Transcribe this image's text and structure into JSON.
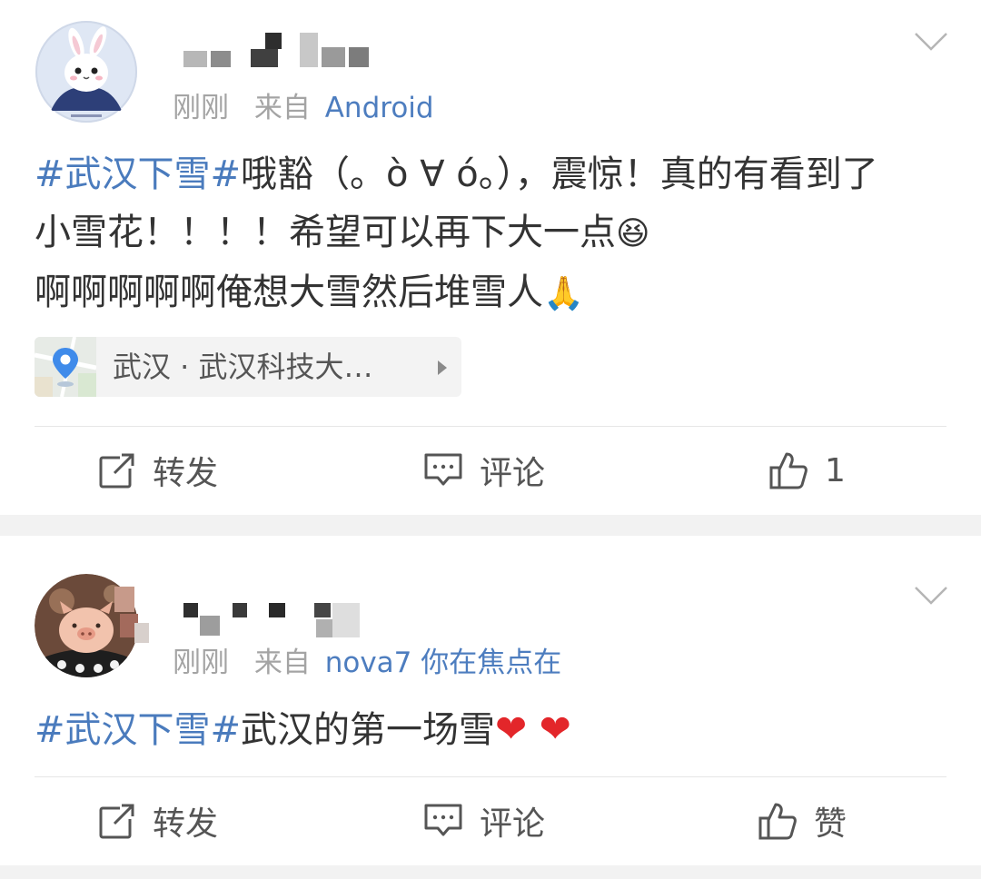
{
  "posts": [
    {
      "time": "刚刚",
      "from_prefix": "来自",
      "source": "Android",
      "topic": "#武汉下雪#",
      "line1": "哦豁（。ò ∀ ó。），震惊！真的有看到了",
      "line2": "小雪花！！！！希望可以再下大一点",
      "line2_emoji": "😆",
      "line3": "啊啊啊啊啊俺想大雪然后堆雪人",
      "line3_emoji": "🙏",
      "location": "武汉 · 武汉科技大…",
      "actions": {
        "repost": "转发",
        "comment": "评论",
        "like": "1"
      }
    },
    {
      "time": "刚刚",
      "from_prefix": "来自",
      "source": "nova7 你在焦点在",
      "topic": "#武汉下雪#",
      "line1": "武汉的第一场雪",
      "hearts": "❤ ❤",
      "actions": {
        "repost": "转发",
        "comment": "评论",
        "like": "赞"
      }
    }
  ],
  "icons": {
    "avatar1": "bunny-avatar",
    "avatar2": "piglet-avatar",
    "menu": "chevron-down-icon",
    "location": "location-pin-icon",
    "repost": "repost-icon",
    "comment": "comment-icon",
    "like": "thumbs-up-icon"
  },
  "colors": {
    "topic": "#4a7bbd",
    "source": "#4d7dbf",
    "meta": "#a4a4a4",
    "heart": "#e3262a",
    "separator": "#f2f2f2"
  }
}
